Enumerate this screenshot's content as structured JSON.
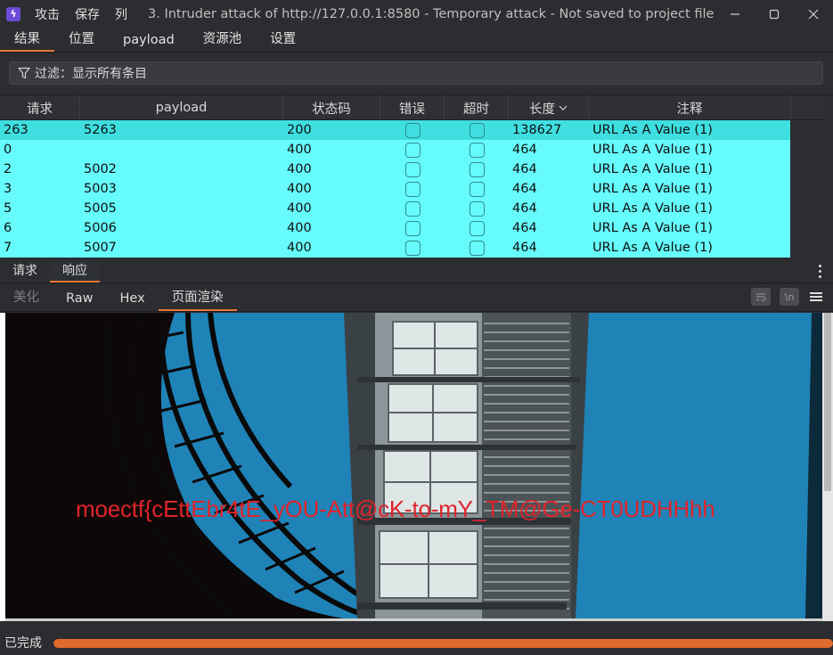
{
  "titlebar": {
    "menu": [
      "攻击",
      "保存",
      "列"
    ],
    "title": "3. Intruder attack of http://127.0.0.1:8580 - Temporary attack - Not saved to project file"
  },
  "top_tabs": [
    {
      "label": "结果",
      "active": true
    },
    {
      "label": "位置",
      "active": false
    },
    {
      "label": "payload",
      "active": false
    },
    {
      "label": "资源池",
      "active": false
    },
    {
      "label": "设置",
      "active": false
    }
  ],
  "filter": {
    "label": "过滤：显示所有条目"
  },
  "table": {
    "columns": [
      {
        "key": "request",
        "label": "请求"
      },
      {
        "key": "payload",
        "label": "payload"
      },
      {
        "key": "status",
        "label": "状态码"
      },
      {
        "key": "error",
        "label": "错误"
      },
      {
        "key": "timeout",
        "label": "超时"
      },
      {
        "key": "length",
        "label": "长度",
        "sorted": "desc"
      },
      {
        "key": "comment",
        "label": "注释"
      }
    ],
    "rows": [
      {
        "request": "263",
        "payload": "5263",
        "status": "200",
        "error": false,
        "timeout": false,
        "length": "138627",
        "comment": "URL As A Value (1)",
        "selected": true
      },
      {
        "request": "0",
        "payload": "",
        "status": "400",
        "error": false,
        "timeout": false,
        "length": "464",
        "comment": "URL As A Value (1)",
        "selected": false
      },
      {
        "request": "2",
        "payload": "5002",
        "status": "400",
        "error": false,
        "timeout": false,
        "length": "464",
        "comment": "URL As A Value (1)",
        "selected": false
      },
      {
        "request": "3",
        "payload": "5003",
        "status": "400",
        "error": false,
        "timeout": false,
        "length": "464",
        "comment": "URL As A Value (1)",
        "selected": false
      },
      {
        "request": "5",
        "payload": "5005",
        "status": "400",
        "error": false,
        "timeout": false,
        "length": "464",
        "comment": "URL As A Value (1)",
        "selected": false
      },
      {
        "request": "6",
        "payload": "5006",
        "status": "400",
        "error": false,
        "timeout": false,
        "length": "464",
        "comment": "URL As A Value (1)",
        "selected": false
      },
      {
        "request": "7",
        "payload": "5007",
        "status": "400",
        "error": false,
        "timeout": false,
        "length": "464",
        "comment": "URL As A Value (1)",
        "selected": false
      }
    ]
  },
  "rr_tabs": [
    {
      "label": "请求",
      "active": false
    },
    {
      "label": "响应",
      "active": true
    }
  ],
  "view_tabs": [
    {
      "label": "美化",
      "active": false,
      "disabled": true
    },
    {
      "label": "Raw",
      "active": false,
      "disabled": false
    },
    {
      "label": "Hex",
      "active": false,
      "disabled": false
    },
    {
      "label": "页面渲染",
      "active": true,
      "disabled": false
    }
  ],
  "view_tools": {
    "ln_label": "\\n"
  },
  "render": {
    "flag_text": "moectf{cEttEbr4tE_yOU-Att@cK-to-mY_TM@Ge-CT0UDHHhh"
  },
  "status": {
    "text": "已完成",
    "progress": 1.0
  },
  "colors": {
    "accent": "#e8773a",
    "row_bg": "#66fbfc",
    "row_selected": "#3fdfe1",
    "flag": "#e0242b",
    "progress": "#e06a2c"
  }
}
